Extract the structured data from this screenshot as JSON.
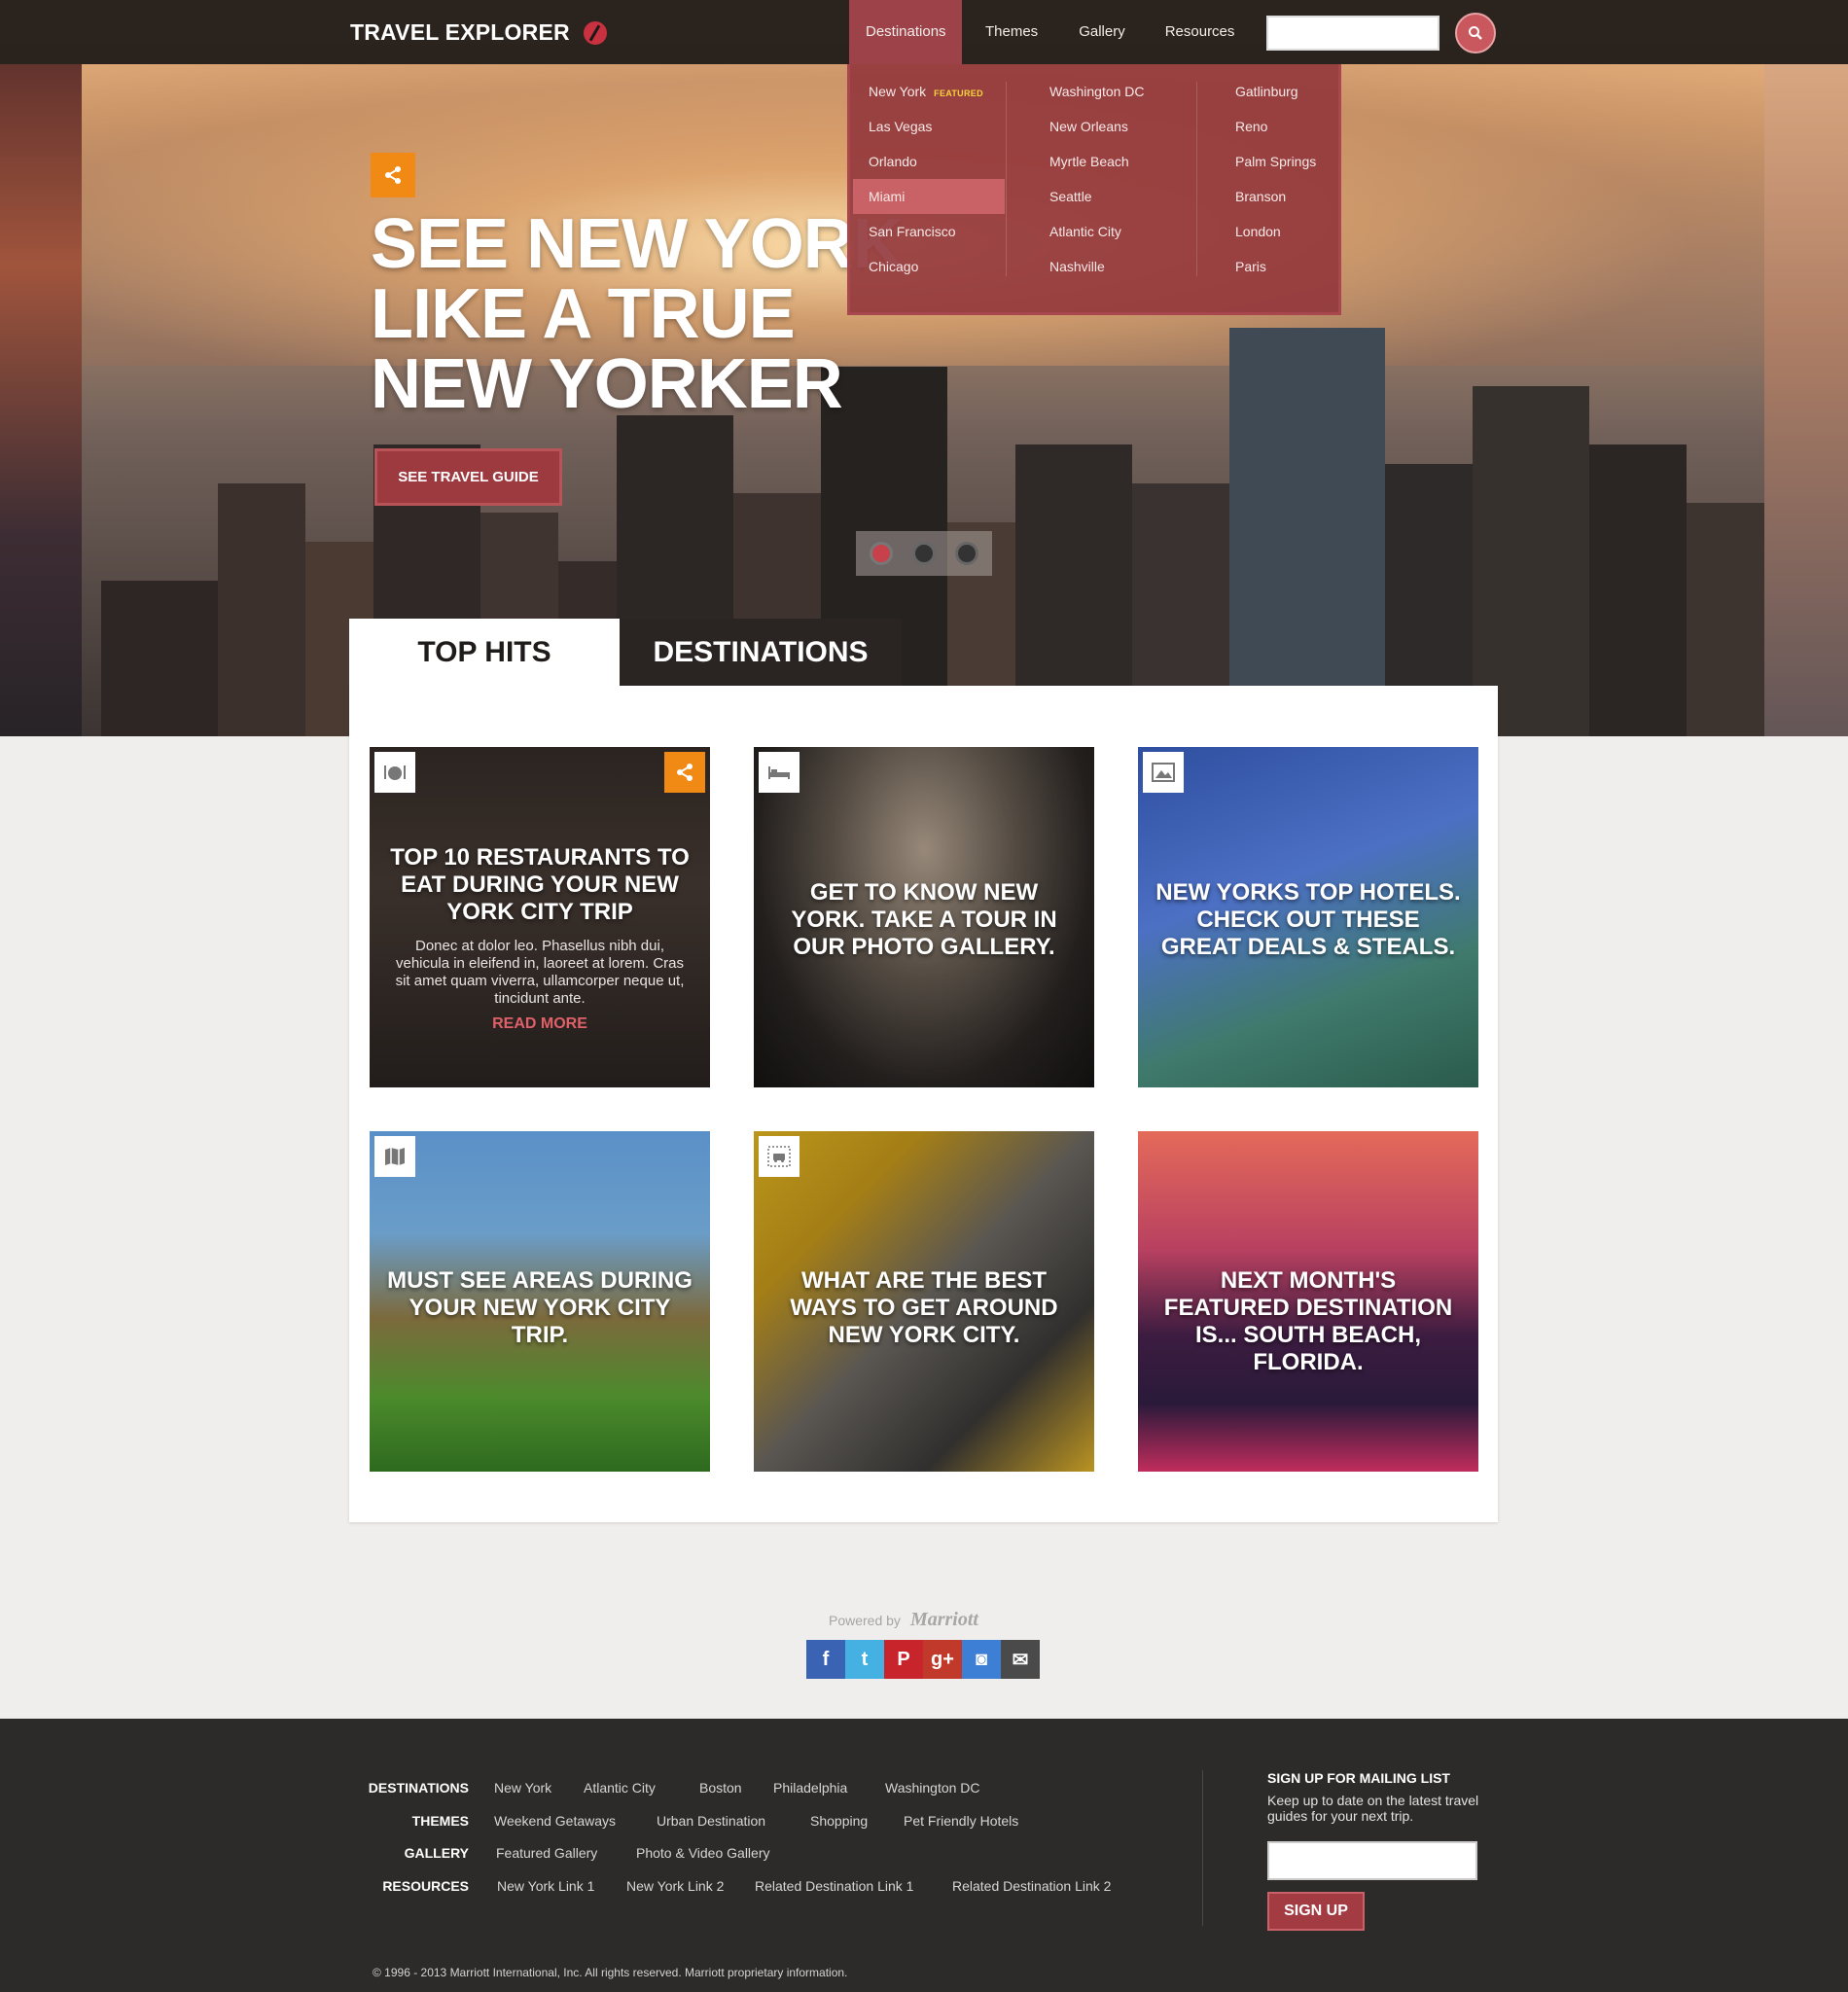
{
  "header": {
    "logo": "TRAVEL EXPLORER",
    "nav": [
      "Destinations",
      "Themes",
      "Gallery",
      "Resources"
    ],
    "search": {
      "placeholder": ""
    }
  },
  "dropdown": {
    "col1": [
      "New York",
      "Las Vegas",
      "Orlando",
      "Miami",
      "San Francisco",
      "Chicago"
    ],
    "col2": [
      "Washington DC",
      "New Orleans",
      "Myrtle Beach",
      "Seattle",
      "Atlantic City",
      "Nashville"
    ],
    "col3": [
      "Gatlinburg",
      "Reno",
      "Palm Springs",
      "Branson",
      "London",
      "Paris"
    ],
    "featured_tag": "FEATURED",
    "active_item": "Miami"
  },
  "hero": {
    "title_lines": [
      "SEE NEW YORK",
      "LIKE A TRUE",
      "NEW YORKER"
    ],
    "cta": "SEE TRAVEL GUIDE",
    "slides": 3,
    "active_slide": 1
  },
  "tabs": [
    "TOP HITS",
    "DESTINATIONS"
  ],
  "cards": [
    {
      "icon": "restaurant-icon",
      "title": "TOP 10 RESTAURANTS TO EAT DURING YOUR NEW YORK CITY TRIP",
      "body": "Donec at dolor leo. Phasellus nibh dui, vehicula in eleifend in, laoreet at lorem. Cras sit amet quam viverra, ullamcorper neque ut, tincidunt ante.",
      "link": "READ MORE"
    },
    {
      "icon": "hotel-bed-icon",
      "title": "GET TO KNOW NEW YORK. TAKE A TOUR IN OUR PHOTO GALLERY."
    },
    {
      "icon": "image-icon",
      "title": "NEW YORKS TOP HOTELS. CHECK OUT THESE GREAT DEALS & STEALS."
    },
    {
      "icon": "map-icon",
      "title": "MUST SEE AREAS DURING YOUR NEW YORK CITY TRIP."
    },
    {
      "icon": "car-icon",
      "title": "WHAT ARE THE BEST WAYS TO GET AROUND NEW YORK CITY."
    },
    {
      "icon": "",
      "title": "NEXT MONTH'S FEATURED DESTINATION IS... SOUTH BEACH, FLORIDA."
    }
  ],
  "powered": {
    "text": "Powered by",
    "brand": "Marriott"
  },
  "social": [
    {
      "name": "facebook-icon",
      "glyph": "f",
      "color": "#3b63b3"
    },
    {
      "name": "twitter-icon",
      "glyph": "t",
      "color": "#45b1e3"
    },
    {
      "name": "pinterest-icon",
      "glyph": "P",
      "color": "#c8242c"
    },
    {
      "name": "google-plus-icon",
      "glyph": "g+",
      "color": "#c0392b"
    },
    {
      "name": "instagram-icon",
      "glyph": "◙",
      "color": "#3d7fd4"
    },
    {
      "name": "email-icon",
      "glyph": "✉",
      "color": "#4a4a4a"
    }
  ],
  "footer": {
    "rows": [
      {
        "label": "DESTINATIONS",
        "links": [
          "New York",
          "Atlantic City",
          "Boston",
          "Philadelphia",
          "Washington DC"
        ]
      },
      {
        "label": "THEMES",
        "links": [
          "Weekend Getaways",
          "Urban Destination",
          "Shopping",
          "Pet Friendly Hotels"
        ]
      },
      {
        "label": "GALLERY",
        "links": [
          "Featured Gallery",
          "Photo & Video Gallery"
        ]
      },
      {
        "label": "RESOURCES",
        "links": [
          "New York Link 1",
          "New York Link 2",
          "Related Destination Link 1",
          "Related Destination Link 2"
        ]
      }
    ],
    "mailing": {
      "title": "SIGN UP FOR MAILING LIST",
      "desc": "Keep up to date on the latest travel guides for your next trip.",
      "button": "SIGN UP"
    },
    "copyright": "© 1996 - 2013 Marriott International, Inc. All rights reserved. Marriott proprietary information."
  }
}
